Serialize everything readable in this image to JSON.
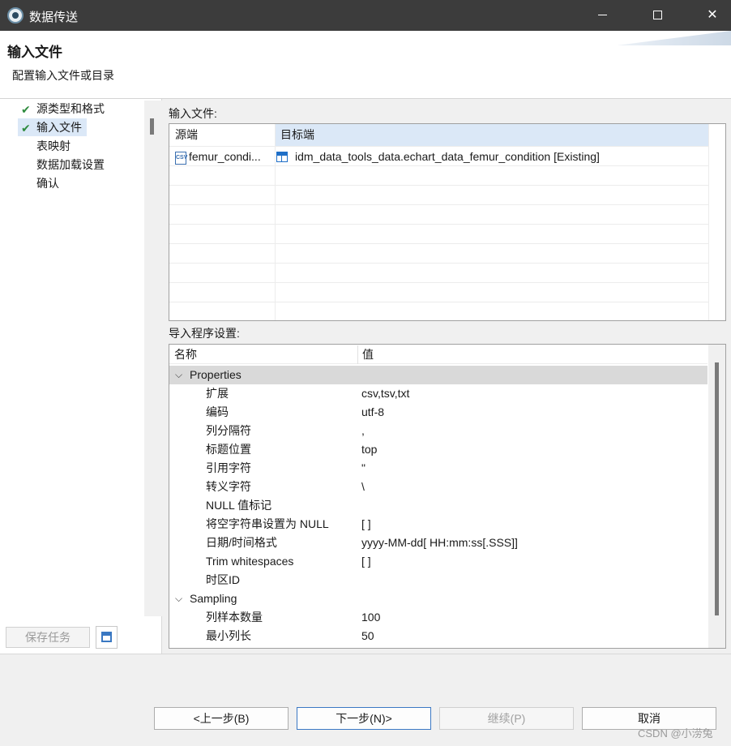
{
  "window": {
    "title": "数据传送"
  },
  "header": {
    "title": "输入文件",
    "description": "配置输入文件或目录"
  },
  "nav": {
    "items": [
      {
        "label": "源类型和格式",
        "done": true
      },
      {
        "label": "输入文件",
        "done": true,
        "selected": true
      },
      {
        "label": "表映射"
      },
      {
        "label": "数据加载设置"
      },
      {
        "label": "确认"
      }
    ]
  },
  "left_actions": {
    "save_task": "保存任务",
    "icon": "save-task-icon"
  },
  "input_files": {
    "label": "输入文件:",
    "headers": {
      "source": "源端",
      "target": "目标端"
    },
    "rows": [
      {
        "source": "femur_condi...",
        "target": "idm_data_tools_data.echart_data_femur_condition [Existing]"
      }
    ]
  },
  "importer": {
    "label": "导入程序设置:",
    "headers": {
      "name": "名称",
      "value": "值"
    },
    "groups": [
      {
        "name": "Properties"
      },
      {
        "name": "Sampling"
      }
    ],
    "properties": [
      {
        "name": "扩展",
        "value": "csv,tsv,txt"
      },
      {
        "name": "编码",
        "value": "utf-8"
      },
      {
        "name": "列分隔符",
        "value": ","
      },
      {
        "name": "标题位置",
        "value": "top"
      },
      {
        "name": "引用字符",
        "value": "\""
      },
      {
        "name": "转义字符",
        "value": "\\"
      },
      {
        "name": "NULL 值标记",
        "value": ""
      },
      {
        "name": "将空字符串设置为 NULL",
        "value": "[ ]"
      },
      {
        "name": "日期/时间格式",
        "value": "yyyy-MM-dd[ HH:mm:ss[.SSS]]"
      },
      {
        "name": "Trim whitespaces",
        "value": "[ ]"
      },
      {
        "name": "时区ID",
        "value": ""
      }
    ],
    "sampling": [
      {
        "name": "列样本数量",
        "value": "100"
      },
      {
        "name": "最小列长",
        "value": "50"
      }
    ]
  },
  "footer": {
    "prev": "<上一步(B)",
    "next": "下一步(N)>",
    "continue": "继续(P)",
    "cancel": "取消",
    "watermark": "CSDN @小涝兔"
  },
  "colors": {
    "selected_bg": "#dbe8f7",
    "check": "#2e8b3e",
    "group_bg": "#d9d9d9",
    "accent": "#3b78c4"
  }
}
